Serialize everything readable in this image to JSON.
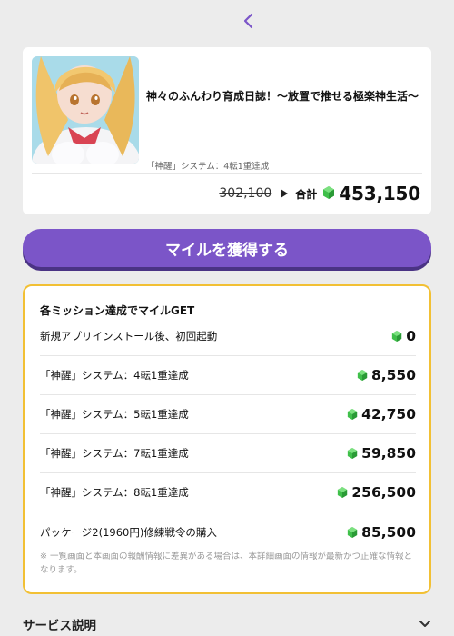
{
  "nav": {
    "back_icon": "chevron-left-icon"
  },
  "game": {
    "title": "神々のふんわり育成日誌！～放置で推せる極楽神生活～",
    "subtitle": "「神醒」システム：4転1重達成",
    "thumbnail_icon": "anime-girl-thumbnail"
  },
  "pricing": {
    "old_price": "302,100",
    "total_label": "合計",
    "total_value": "453,150"
  },
  "cta": {
    "label": "マイルを獲得する"
  },
  "missions": {
    "header": "各ミッション達成でマイルGET",
    "items": [
      {
        "label": "新規アプリインストール後、初回起動",
        "value": "0"
      },
      {
        "label": "「神醒」システム：4転1重達成",
        "value": "8,550"
      },
      {
        "label": "「神醒」システム：5転1重達成",
        "value": "42,750"
      },
      {
        "label": "「神醒」システム：7転1重達成",
        "value": "59,850"
      },
      {
        "label": "「神醒」システム：8転1重達成",
        "value": "256,500"
      },
      {
        "label": "パッケージ2(1960円)修練戦令の購入",
        "value": "85,500"
      }
    ],
    "disclaimer": "※ 一覧画面と本画面の報酬情報に差異がある場合は、本詳細画面の情報が最新かつ正確な情報となります。"
  },
  "service": {
    "label": "サービス説明"
  },
  "colors": {
    "accent": "#7b55c8",
    "border": "#f2c034",
    "gem": "#3fbf4a"
  }
}
